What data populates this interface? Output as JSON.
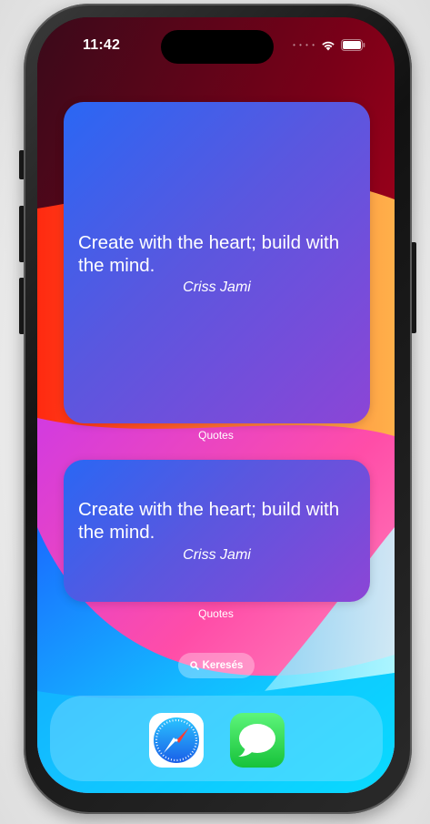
{
  "status": {
    "time": "11:42"
  },
  "widgets": [
    {
      "quote": "Create with the heart; build with the mind.",
      "author": "Criss Jami",
      "label": "Quotes"
    },
    {
      "quote": "Create with the heart; build with the mind.",
      "author": "Criss Jami",
      "label": "Quotes"
    }
  ],
  "search": {
    "label": "Keresés"
  },
  "dock": {
    "apps": [
      "Safari",
      "Messages"
    ]
  },
  "colors": {
    "widget_start": "#2a67f4",
    "widget_end": "#8c45d6"
  }
}
